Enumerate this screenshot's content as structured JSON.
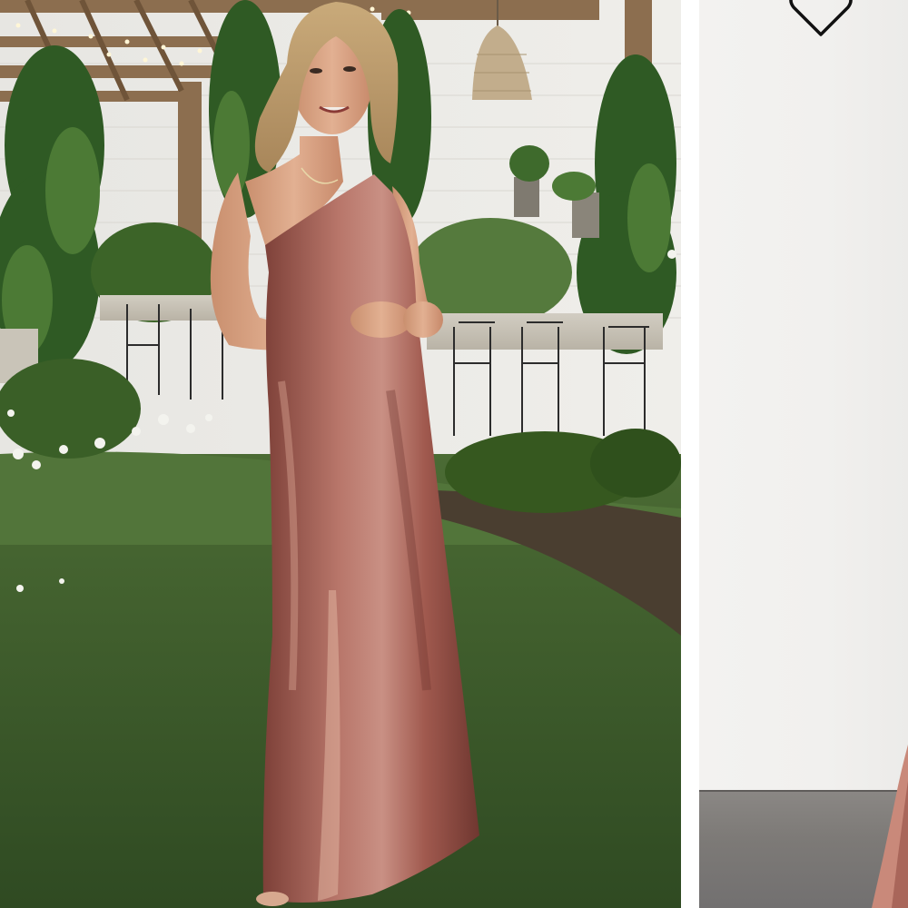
{
  "carousel": {
    "slides": [
      {
        "name": "garden-photo",
        "scene": "outdoor-garden",
        "dress_color": "#a9665a"
      },
      {
        "name": "studio-photo",
        "scene": "studio",
        "dress_color": "#c9897a"
      }
    ]
  },
  "favorite": {
    "icon": "heart-outline-icon",
    "color": "#111111"
  },
  "colors": {
    "grass": "#3f5f2c",
    "wall": "#e9e8e4",
    "velvet": "#a9665a",
    "studio_wall": "#f1f0ee",
    "studio_floor": "#807d7a"
  }
}
